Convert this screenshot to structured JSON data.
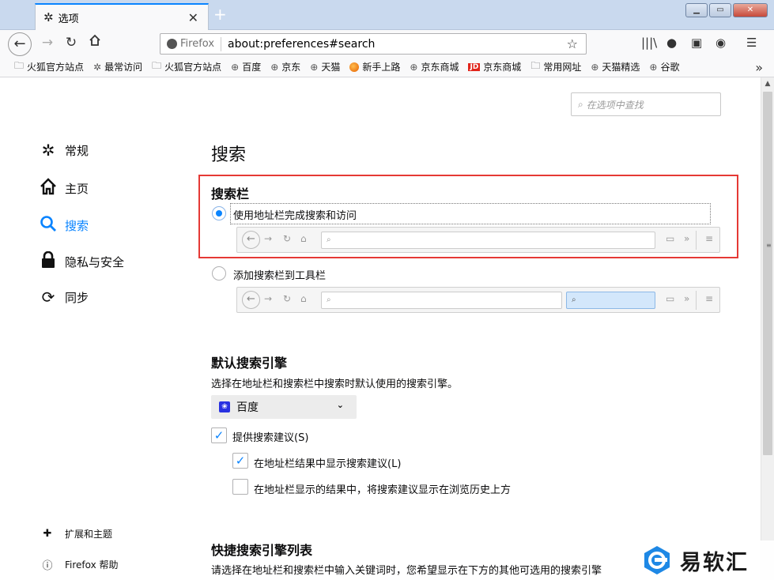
{
  "window": {
    "tab_title": "选项",
    "new_tab": "+",
    "tab_close": "✕",
    "buttons": [
      "▁",
      "▭",
      "✕"
    ]
  },
  "navbar": {
    "identity_label": "Firefox",
    "url": "about:preferences#search"
  },
  "bookmarks": [
    {
      "icon": "folder-icon",
      "label": "火狐官方站点"
    },
    {
      "icon": "gear-icon",
      "label": "最常访问"
    },
    {
      "icon": "folder-icon",
      "label": "火狐官方站点"
    },
    {
      "icon": "globe-icon",
      "label": "百度"
    },
    {
      "icon": "globe-icon",
      "label": "京东"
    },
    {
      "icon": "globe-icon",
      "label": "天猫"
    },
    {
      "icon": "firefox-icon",
      "label": "新手上路"
    },
    {
      "icon": "globe-icon",
      "label": "京东商城"
    },
    {
      "icon": "jd-icon",
      "label": "京东商城"
    },
    {
      "icon": "folder-icon",
      "label": "常用网址"
    },
    {
      "icon": "globe-icon",
      "label": "天猫精选"
    },
    {
      "icon": "globe-icon",
      "label": "谷歌"
    }
  ],
  "prefs_search": {
    "placeholder": "在选项中查找"
  },
  "sidebar": {
    "items": [
      {
        "icon": "gear-icon",
        "label": "常规"
      },
      {
        "icon": "home-icon",
        "label": "主页"
      },
      {
        "icon": "search-icon",
        "label": "搜索"
      },
      {
        "icon": "lock-icon",
        "label": "隐私与安全"
      },
      {
        "icon": "sync-icon",
        "label": "同步"
      }
    ],
    "footer": [
      {
        "icon": "puzzle-icon",
        "label": "扩展和主题"
      },
      {
        "icon": "help-icon",
        "label": "Firefox 帮助"
      }
    ]
  },
  "main": {
    "title": "搜索",
    "searchbar_heading": "搜索栏",
    "option_urlbar": "使用地址栏完成搜索和访问",
    "option_toolbar": "添加搜索栏到工具栏",
    "default_engine_heading": "默认搜索引擎",
    "default_engine_desc": "选择在地址栏和搜索栏中搜索时默认使用的搜索引擎。",
    "default_engine_value": "百度",
    "suggest_label": "提供搜索建议(S)",
    "suggest_urlbar_label": "在地址栏结果中显示搜索建议(L)",
    "suggest_before_history_label": "在地址栏显示的结果中，将搜索建议显示在浏览历史上方",
    "oneclick_heading": "快捷搜索引擎列表",
    "oneclick_desc": "请选择在地址栏和搜索栏中输入关键词时，您希望显示在下方的其他可选用的搜索引擎"
  },
  "state": {
    "selected_search_mode": "urlbar",
    "suggest_checked": true,
    "suggest_urlbar_checked": true,
    "suggest_before_history_checked": false
  },
  "watermark": {
    "text": "易软汇"
  },
  "colors": {
    "accent": "#0a84ff",
    "highlight_box": "#e53935"
  }
}
